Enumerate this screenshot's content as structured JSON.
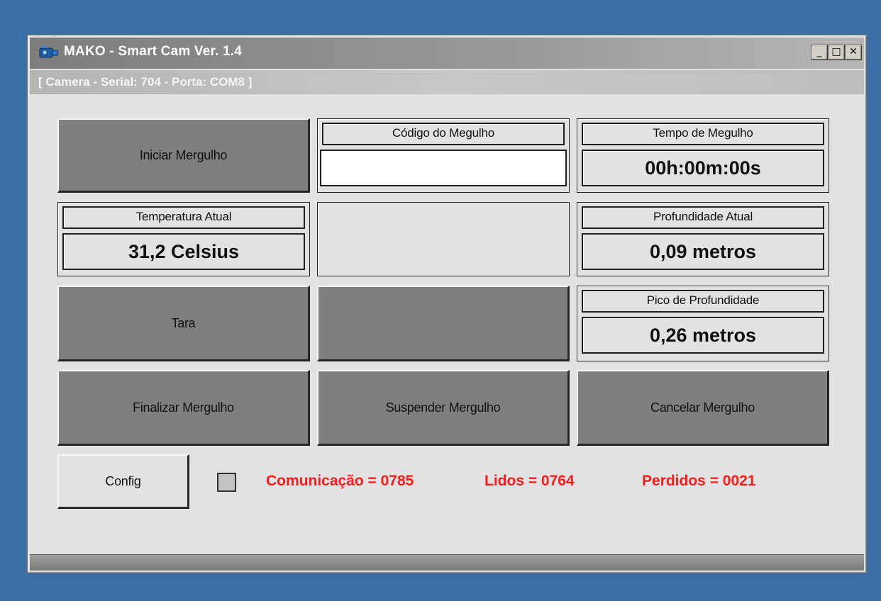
{
  "window": {
    "title": "MAKO - Smart Cam Ver. 1.4",
    "subtitle": "[ Camera - Serial: 704 - Porta: COM8 ]",
    "controls": {
      "minimize": "_",
      "maximize": "□",
      "close": "✕"
    }
  },
  "buttons": {
    "start": "Iniciar Mergulho",
    "tare": "Tara",
    "finish": "Finalizar Mergulho",
    "suspend": "Suspender Mergulho",
    "cancel": "Cancelar Mergulho",
    "config": "Config",
    "blank": ""
  },
  "panels": {
    "dive_code": {
      "label": "Código do Megulho",
      "value": ""
    },
    "dive_time": {
      "label": "Tempo de Megulho",
      "value": "00h:00m:00s"
    },
    "temperature": {
      "label": "Temperatura Atual",
      "value": "31,2 Celsius"
    },
    "depth": {
      "label": "Profundidade Atual",
      "value": "0,09 metros"
    },
    "peak_depth": {
      "label": "Pico de Profundidade",
      "value": "0,26 metros"
    }
  },
  "status": {
    "communication": "Comunicação = 0785",
    "read": "Lidos = 0764",
    "lost": "Perdidos = 0021",
    "color": "#ff1a1a"
  },
  "icons": {
    "app": "camera-icon",
    "indicator": "status-indicator"
  }
}
